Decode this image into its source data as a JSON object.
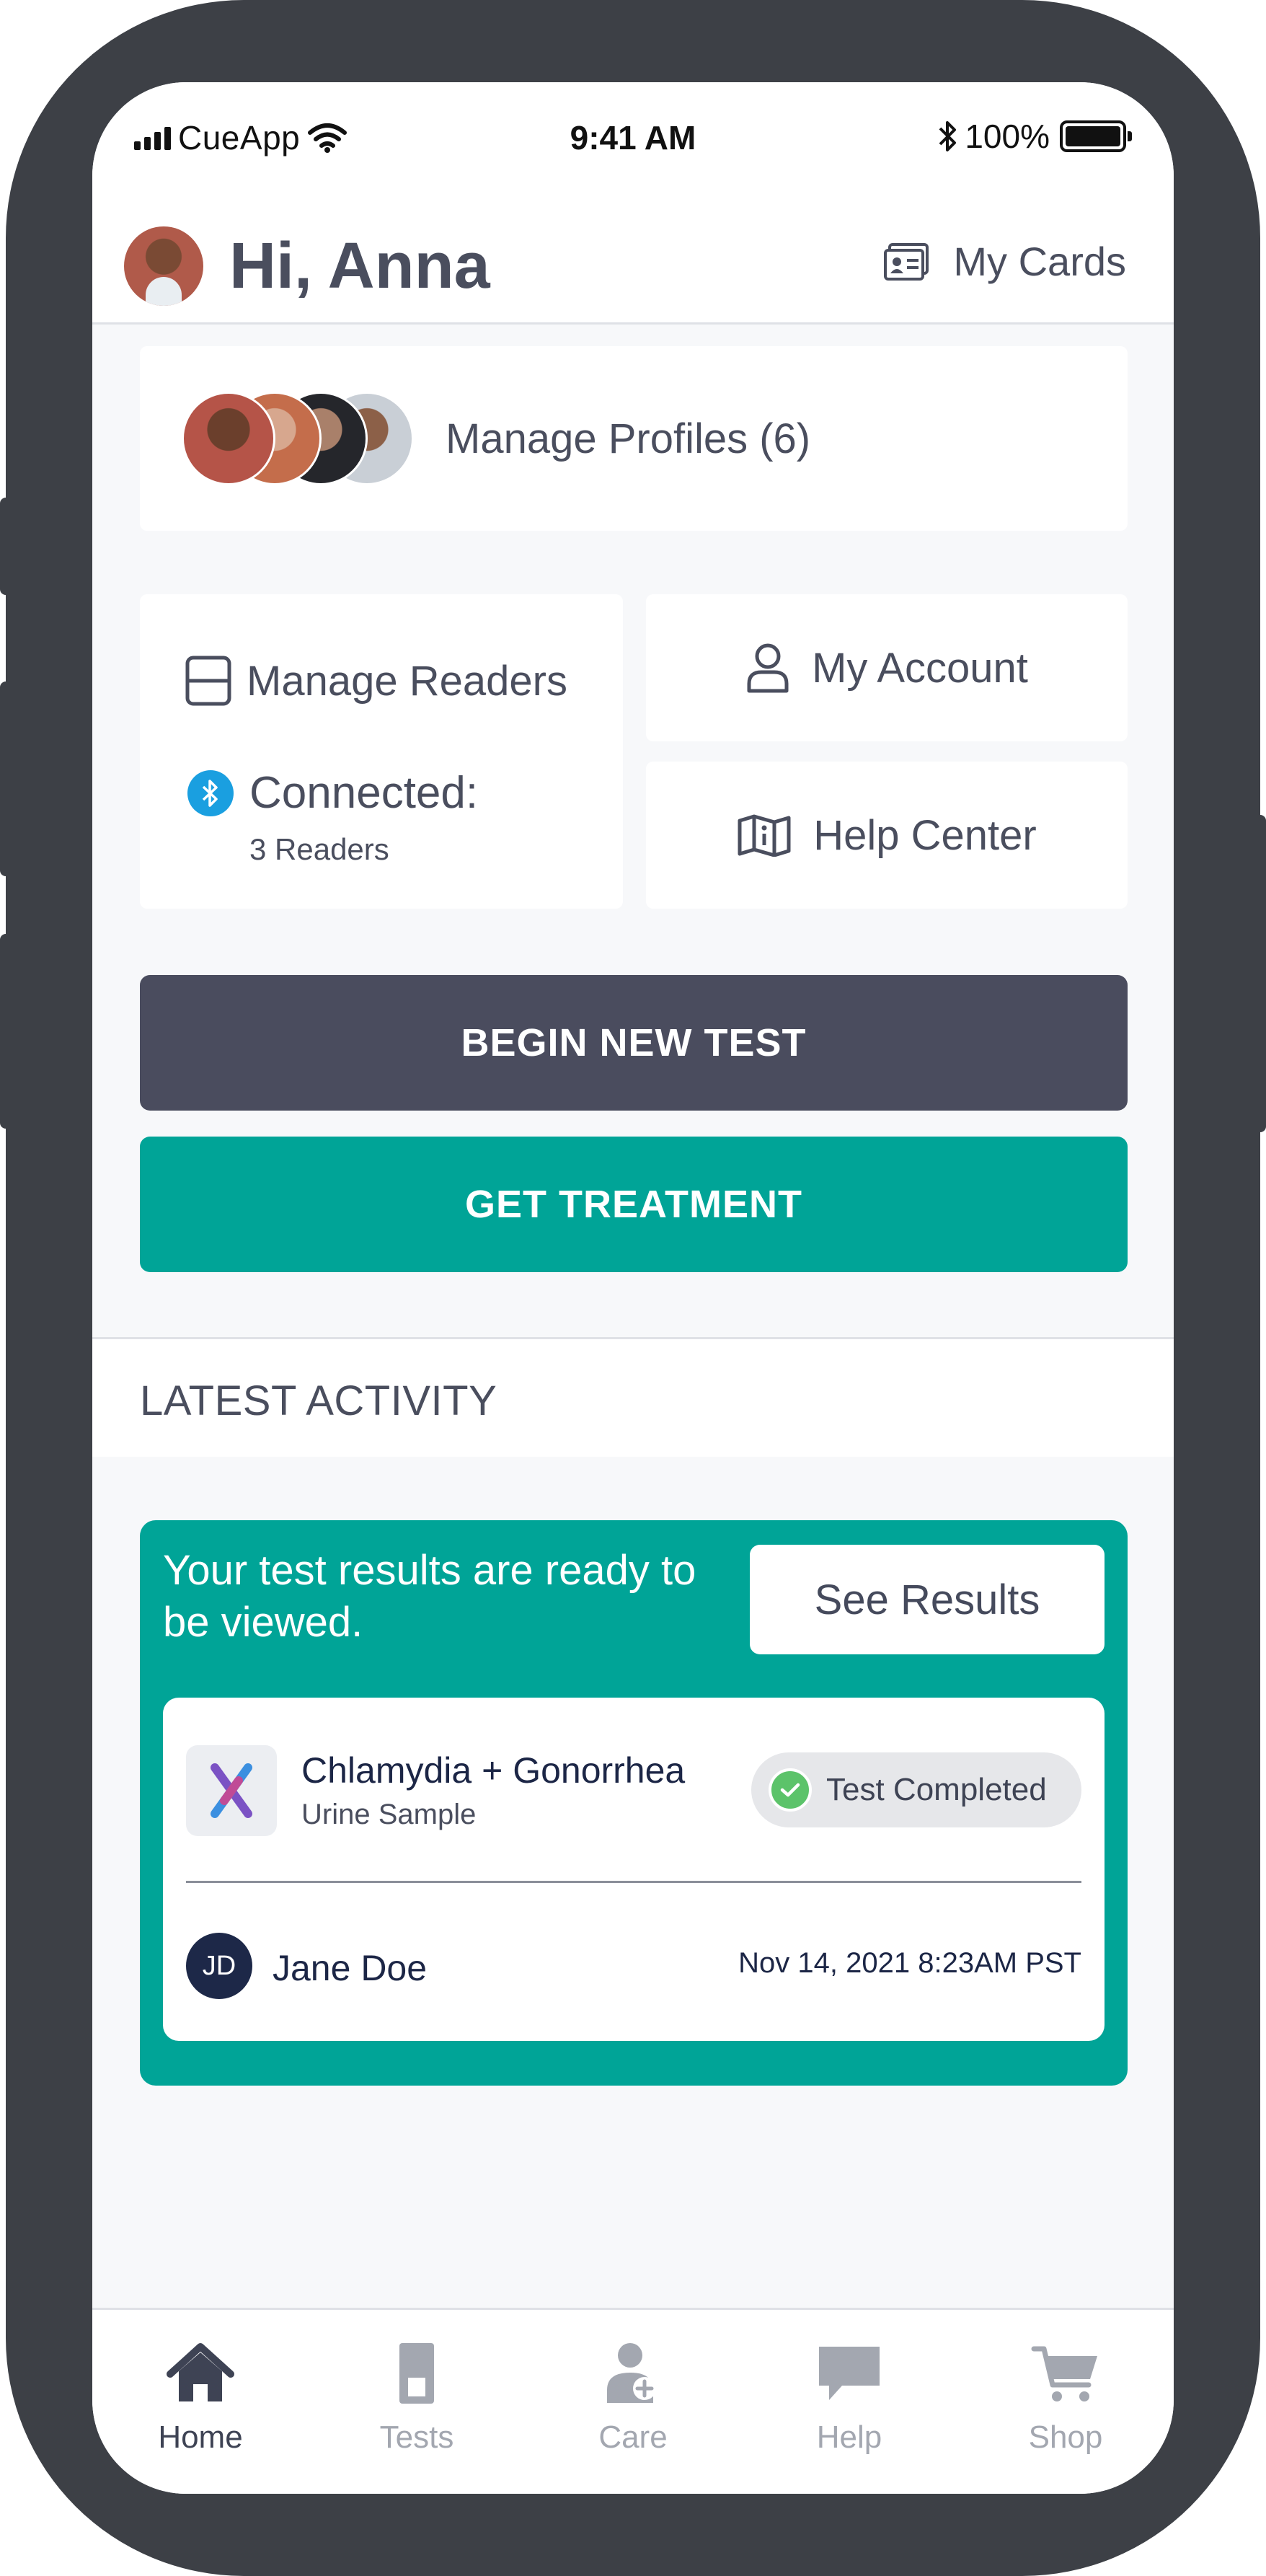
{
  "status_bar": {
    "carrier": "CueApp",
    "time": "9:41 AM",
    "bluetooth_glyph": "✱",
    "battery": "100%"
  },
  "header": {
    "greeting": "Hi, Anna",
    "my_cards": "My Cards",
    "icons": {
      "profile": "avatar",
      "cards": "id-card-icon"
    }
  },
  "profiles": {
    "label": "Manage Profiles (6)"
  },
  "readers": {
    "title": "Manage Readers",
    "connected_label": "Connected:",
    "connected_count": "3 Readers",
    "bluetooth_symbol": "ᛒ"
  },
  "account": {
    "label": "My Account"
  },
  "help_center": {
    "label": "Help Center"
  },
  "actions": {
    "begin_test": "BEGIN NEW TEST",
    "get_treatment": "GET TREATMENT"
  },
  "activity": {
    "title": "LATEST ACTIVITY",
    "ready_message": "Your test results are ready to be viewed.",
    "see_results": "See Results",
    "test": {
      "name": "Chlamydia + Gonorrhea",
      "sample": "Urine Sample",
      "status": "Test Completed"
    },
    "person": {
      "initials": "JD",
      "name": "Jane Doe",
      "date": "Nov 14, 2021 8:23AM PST"
    }
  },
  "tabs": [
    {
      "label": "Home",
      "icon": "home-icon",
      "active": true
    },
    {
      "label": "Tests",
      "icon": "test-kit-icon",
      "active": false
    },
    {
      "label": "Care",
      "icon": "care-icon",
      "active": false
    },
    {
      "label": "Help",
      "icon": "chat-icon",
      "active": false
    },
    {
      "label": "Shop",
      "icon": "cart-icon",
      "active": false
    }
  ],
  "colors": {
    "teal": "#00a497",
    "slate": "#4a4c5e",
    "bluetooth": "#1a9fe0",
    "check_green": "#5cc36a",
    "frame": "#3d4046"
  }
}
